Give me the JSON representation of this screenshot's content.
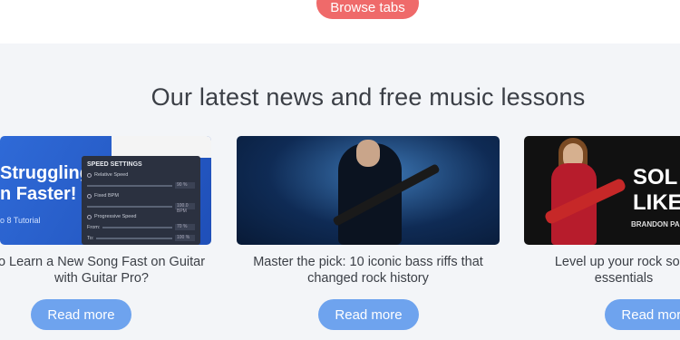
{
  "header": {
    "browse_label": "Browse tabs"
  },
  "section": {
    "title": "Our latest news and free music lessons"
  },
  "cards": [
    {
      "image_text_1": "Struggling,",
      "image_text_2": "n Faster!",
      "image_sub": "o 8 Tutorial",
      "panel_title": "SPEED SETTINGS",
      "panel_opt1": "Relative Speed",
      "panel_opt1_val": "90 %",
      "panel_opt2": "Fixed BPM",
      "panel_opt2_val": "100.0 BPM",
      "panel_opt3": "Progressive Speed",
      "panel_from": "From:",
      "panel_from_val": "70 %",
      "panel_to": "To:",
      "panel_to_val": "100 %",
      "title_line1": "o Learn a New Song Fast on Guitar",
      "title_line2": "with Guitar Pro?",
      "button": "Read more"
    },
    {
      "title_line1": "Master the pick: 10 iconic bass riffs that",
      "title_line2": "changed rock history",
      "button": "Read more"
    },
    {
      "image_text_1": "SOL",
      "image_text_2": "LIKE",
      "image_sub": "BRANDON PAL",
      "title_line1": "Level up your rock soloi",
      "title_line2": "essentials",
      "button": "Read more"
    }
  ],
  "colors": {
    "accent_red": "#ef6a6a",
    "button_blue": "#6ea3ee",
    "text": "#3b3f46"
  }
}
